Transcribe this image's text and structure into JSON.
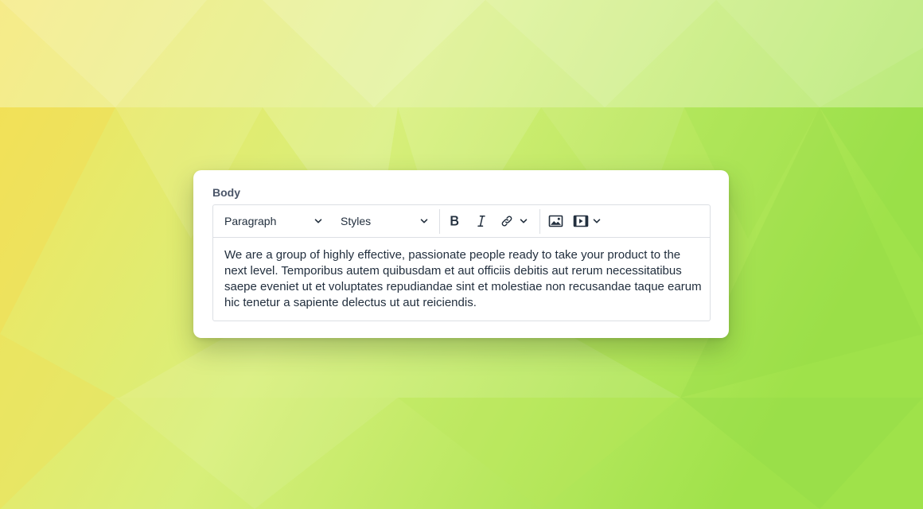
{
  "field": {
    "label": "Body"
  },
  "toolbar": {
    "block_format": "Paragraph",
    "styles": "Styles",
    "icons": [
      "chevron-down-icon",
      "bold-icon",
      "italic-icon",
      "link-icon",
      "image-icon",
      "media-icon"
    ]
  },
  "editor": {
    "content": "We are a group of highly effective, passionate people ready to take your product to the next level. Temporibus autem quibusdam et aut officiis debitis aut rerum necessitatibus saepe eveniet ut et voluptates repudiandae sint et molestiae non recusandae taque earum hic tenetur a sapiente delectus ut aut reiciendis."
  },
  "colors": {
    "background_left": "#f0e25a",
    "background_right": "#9fe24a",
    "text": "#222f3e",
    "label": "#4a5568",
    "border": "#dcdfe4"
  }
}
